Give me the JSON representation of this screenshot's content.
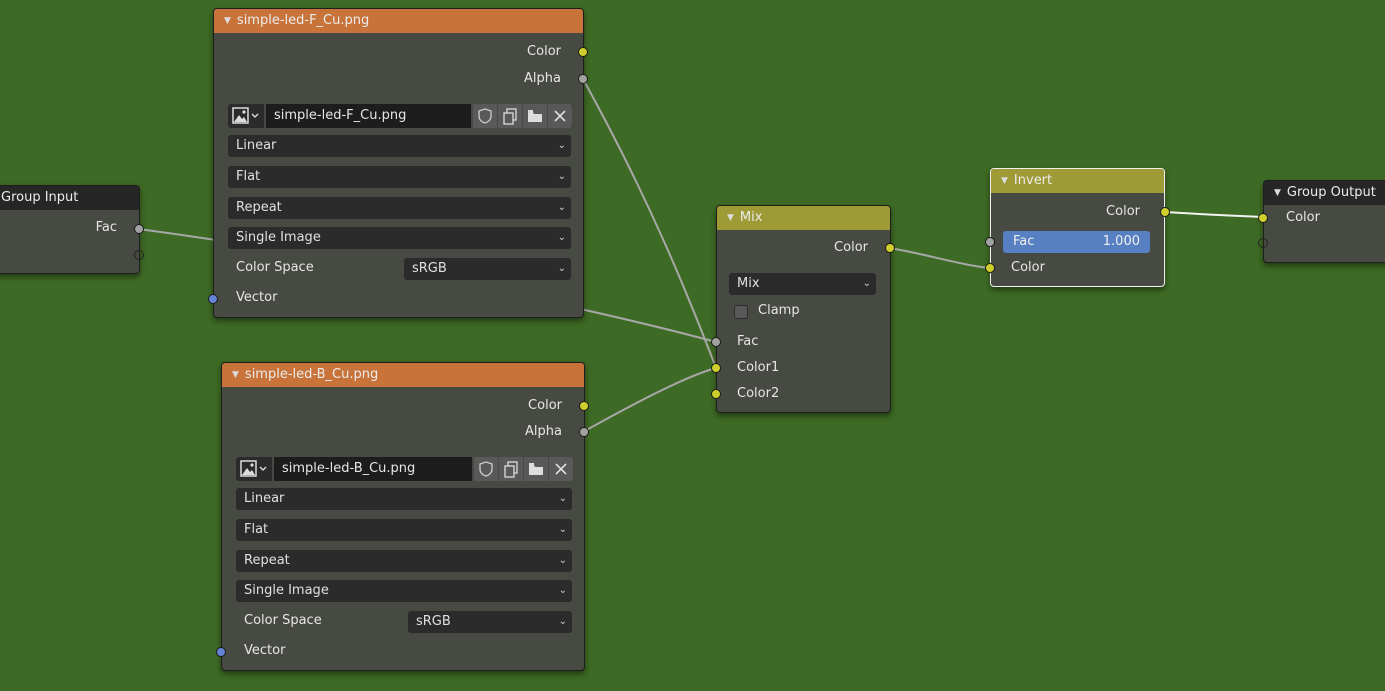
{
  "colors": {
    "background": "#3d6a24",
    "node_body": "#474a43",
    "texture_header": "#c7733a",
    "group_header": "#262626",
    "color_header": "#9e9a36",
    "socket_color": "#cfcf2e",
    "socket_float": "#a1a1a1",
    "socket_vector": "#6482d6",
    "slider_fill": "#5680c2"
  },
  "group_input": {
    "title": "Group Input",
    "outputs": {
      "fac": "Fac"
    }
  },
  "image_nodes": [
    {
      "title": "simple-led-F_Cu.png",
      "outputs": {
        "color": "Color",
        "alpha": "Alpha"
      },
      "image_name": "simple-led-F_Cu.png",
      "interpolation": "Linear",
      "projection": "Flat",
      "extension": "Repeat",
      "source": "Single Image",
      "color_space_label": "Color Space",
      "color_space": "sRGB",
      "inputs": {
        "vector": "Vector"
      },
      "icons": [
        "image-type-icon",
        "fake-user-shield-icon",
        "duplicate-icon",
        "open-folder-icon",
        "unlink-x-icon"
      ]
    },
    {
      "title": "simple-led-B_Cu.png",
      "outputs": {
        "color": "Color",
        "alpha": "Alpha"
      },
      "image_name": "simple-led-B_Cu.png",
      "interpolation": "Linear",
      "projection": "Flat",
      "extension": "Repeat",
      "source": "Single Image",
      "color_space_label": "Color Space",
      "color_space": "sRGB",
      "inputs": {
        "vector": "Vector"
      },
      "icons": [
        "image-type-icon",
        "fake-user-shield-icon",
        "duplicate-icon",
        "open-folder-icon",
        "unlink-x-icon"
      ]
    }
  ],
  "mix_node": {
    "title": "Mix",
    "outputs": {
      "color": "Color"
    },
    "blend_mode": "Mix",
    "clamp_label": "Clamp",
    "clamp_checked": false,
    "inputs": {
      "fac": "Fac",
      "color1": "Color1",
      "color2": "Color2"
    }
  },
  "invert_node": {
    "title": "Invert",
    "outputs": {
      "color": "Color"
    },
    "fac_label": "Fac",
    "fac_value": "1.000",
    "inputs": {
      "color": "Color"
    }
  },
  "group_output": {
    "title": "Group Output",
    "inputs": {
      "color": "Color"
    }
  }
}
